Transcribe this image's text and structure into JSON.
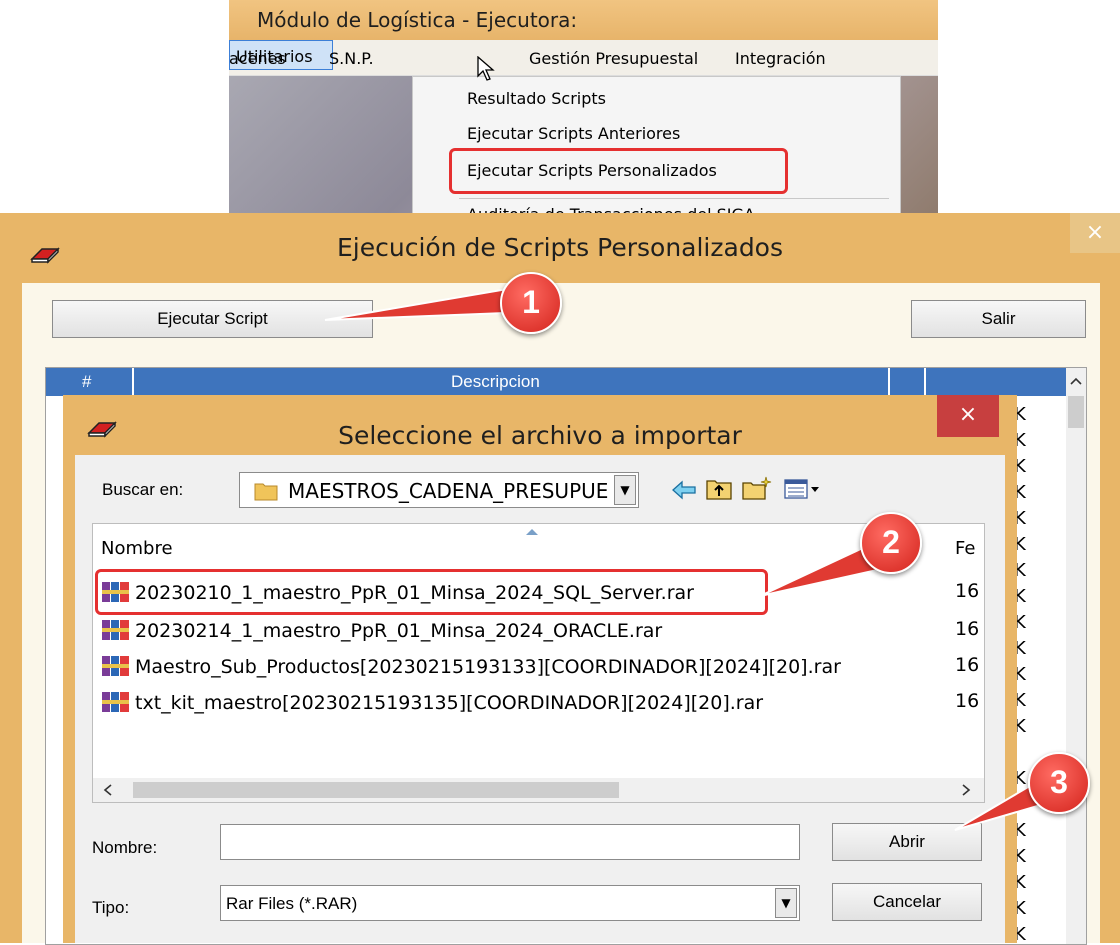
{
  "top_window": {
    "title": "Módulo de Logística - Ejecutora:",
    "menu": [
      "acenes",
      "S.N.P.",
      "Utilitarios",
      "Gestión Presupuestal",
      "Integración"
    ],
    "dropdown": [
      "Resultado Scripts",
      "Ejecutar Scripts Anteriores",
      "Ejecutar Scripts Personalizados",
      "Auditoría de Transacciones del SIGA"
    ]
  },
  "main_dialog": {
    "title": "Ejecución de Scripts Personalizados",
    "close_label": "×",
    "execute_button": "Ejecutar Script",
    "exit_button": "Salir",
    "grid_headers": [
      "#",
      "Descripcion"
    ]
  },
  "file_dialog": {
    "title": "Seleccione el archivo a importar",
    "close_label": "×",
    "look_in_label": "Buscar en:",
    "look_in_value": "MAESTROS_CADENA_PRESUPUESTAL",
    "columns": [
      "Nombre",
      "Fe"
    ],
    "files": [
      {
        "name": "20230210_1_maestro_PpR_01_Minsa_2024_SQL_Server.rar",
        "date": "16"
      },
      {
        "name": "20230214_1_maestro_PpR_01_Minsa_2024_ORACLE.rar",
        "date": "16"
      },
      {
        "name": "Maestro_Sub_Productos[20230215193133][COORDINADOR][2024][20].rar",
        "date": "16"
      },
      {
        "name": "txt_kit_maestro[20230215193135][COORDINADOR][2024][20].rar",
        "date": "16"
      }
    ],
    "filename_label": "Nombre:",
    "filename_value": "",
    "filetype_label": "Tipo:",
    "filetype_value": "Rar Files (*.RAR)",
    "open_button": "Abrir",
    "cancel_button": "Cancelar"
  },
  "callouts": [
    "1",
    "2",
    "3"
  ],
  "colors": {
    "title_bar": "#e8b668",
    "grid_header": "#3e74bd",
    "highlight": "#e53030"
  }
}
